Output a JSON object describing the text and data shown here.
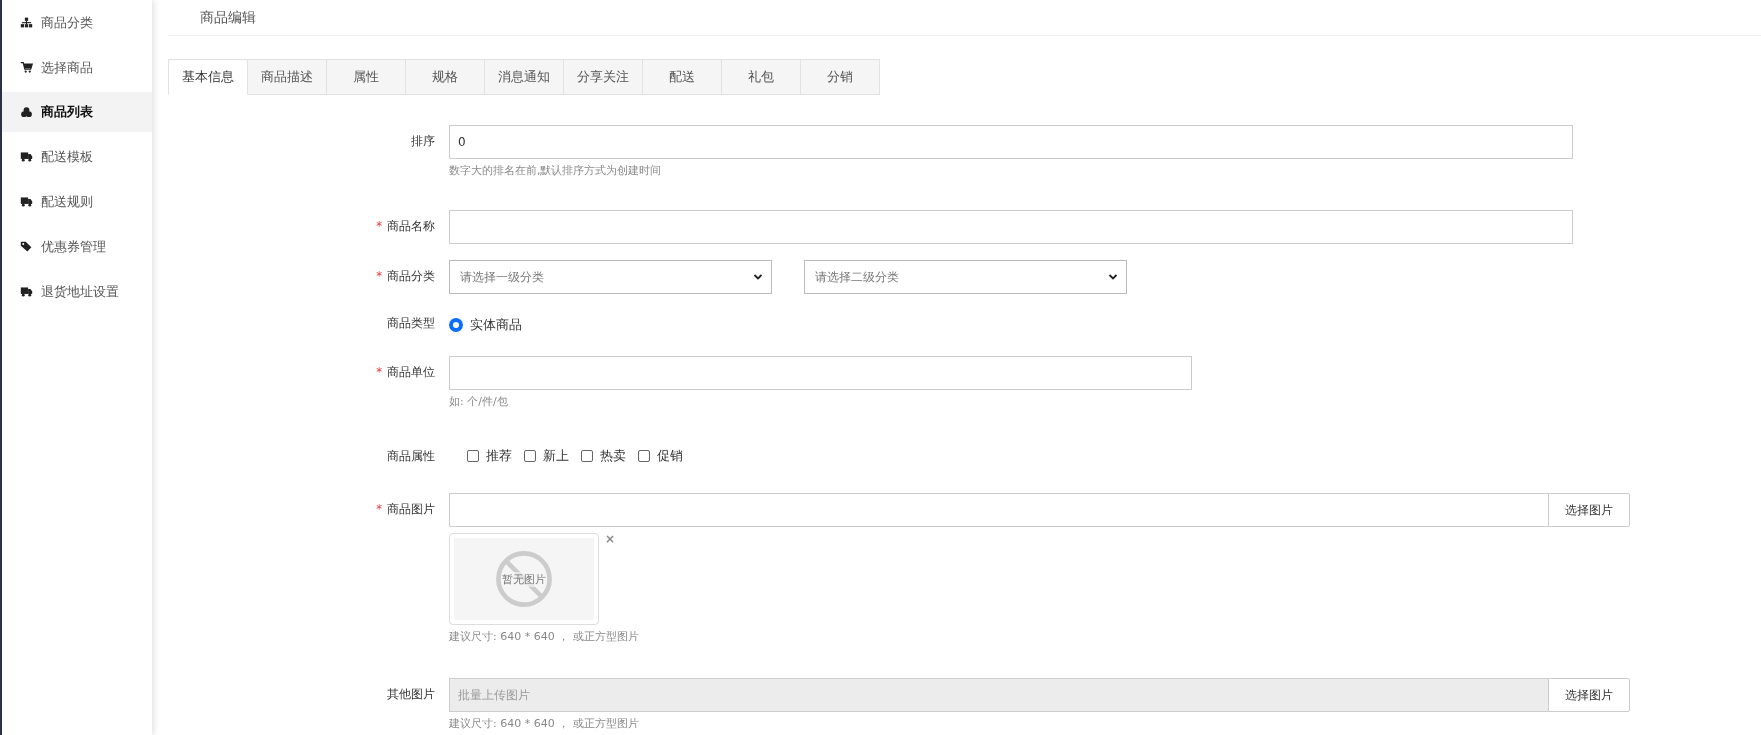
{
  "sidebar": {
    "items": [
      {
        "label": "商品分类",
        "selected": false
      },
      {
        "label": "选择商品",
        "selected": false
      },
      {
        "label": "商品列表",
        "selected": true
      },
      {
        "label": "配送模板",
        "selected": false
      },
      {
        "label": "配送规则",
        "selected": false
      },
      {
        "label": "优惠券管理",
        "selected": false
      },
      {
        "label": "退货地址设置",
        "selected": false
      }
    ]
  },
  "page_title": "商品编辑",
  "tabs": [
    {
      "label": "基本信息",
      "selected": true
    },
    {
      "label": "商品描述",
      "selected": false
    },
    {
      "label": "属性",
      "selected": false
    },
    {
      "label": "规格",
      "selected": false
    },
    {
      "label": "消息通知",
      "selected": false
    },
    {
      "label": "分享关注",
      "selected": false
    },
    {
      "label": "配送",
      "selected": false
    },
    {
      "label": "礼包",
      "selected": false
    },
    {
      "label": "分销",
      "selected": false
    }
  ],
  "form": [
    {
      "kind": "text",
      "label": "排序",
      "value": "0",
      "hint": "数字大的排名在前,默认排序方式为创建时间"
    },
    {
      "kind": "text",
      "label": "商品名称",
      "required_mark": "*"
    },
    {
      "kind": "selects",
      "label": "商品分类",
      "required_mark": "*",
      "selects": [
        "请选择一级分类",
        "请选择二级分类"
      ]
    },
    {
      "kind": "radio",
      "label": "商品类型",
      "options": [
        {
          "label": "实体商品",
          "selected": true
        }
      ]
    },
    {
      "kind": "text",
      "label": "商品单位",
      "required_mark": "*",
      "hint": "如: 个/件/包"
    },
    {
      "kind": "checks",
      "label": "商品属性",
      "options": [
        {
          "label": "推荐",
          "checked": false
        },
        {
          "label": "新上",
          "checked": false
        },
        {
          "label": "热卖",
          "checked": false
        },
        {
          "label": "促销",
          "checked": false
        }
      ]
    },
    {
      "kind": "image",
      "label": "商品图片",
      "required_mark": "*",
      "button": "选择图片",
      "thumb_text": "暂无图片",
      "remove": "×",
      "hint": "建议尺寸: 640 * 640 ，  或正方型图片"
    },
    {
      "kind": "image",
      "label": "其他图片",
      "placeholder": "批量上传图片",
      "button": "选择图片",
      "disabled": true,
      "hint": "建议尺寸: 640 * 640 ，  或正方型图片"
    }
  ]
}
